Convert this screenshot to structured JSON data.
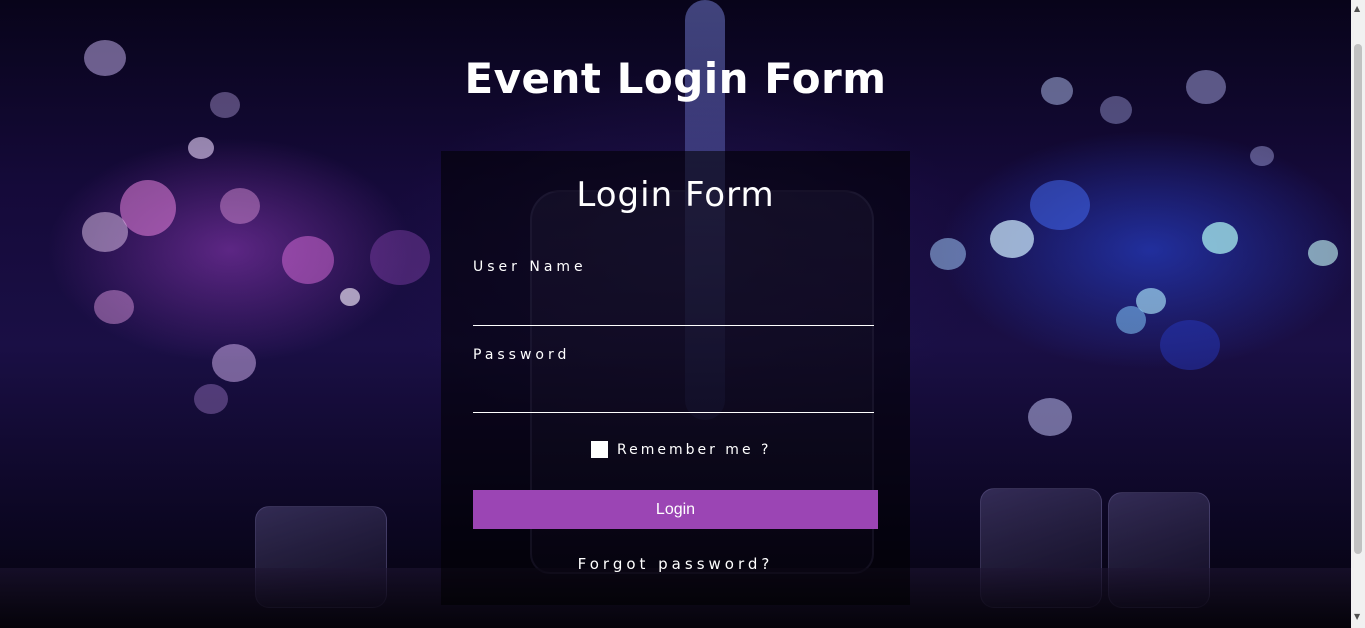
{
  "page": {
    "title": "Event Login Form"
  },
  "form": {
    "heading": "Login Form",
    "username_label": "User Name",
    "username_value": "",
    "password_label": "Password",
    "password_value": "",
    "remember_label": "Remember me ?",
    "remember_checked": false,
    "login_button": "Login",
    "forgot_link": "Forgot password?"
  },
  "colors": {
    "button": "#9b45b4",
    "panel": "rgba(0,0,0,0.55)",
    "text": "#ffffff"
  }
}
